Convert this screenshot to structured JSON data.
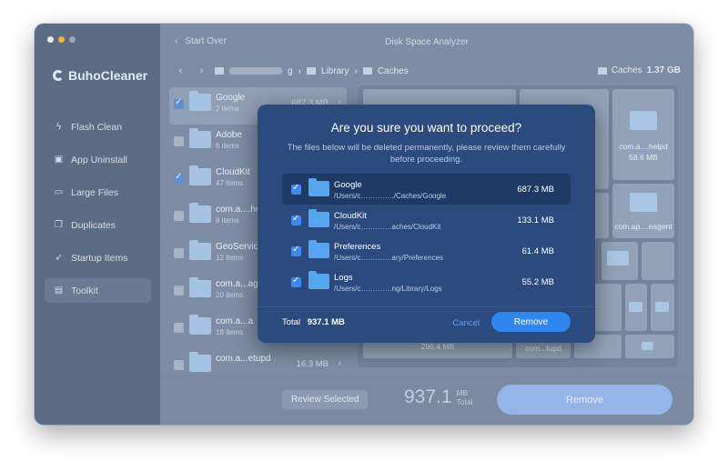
{
  "app": {
    "brand": "BuhoCleaner",
    "window_title": "Disk Space Analyzer",
    "start_over": "Start Over"
  },
  "sidebar": {
    "items": [
      {
        "label": "Flash Clean",
        "icon": "flash-icon"
      },
      {
        "label": "App Uninstall",
        "icon": "uninstall-icon"
      },
      {
        "label": "Large Files",
        "icon": "large-files-icon"
      },
      {
        "label": "Duplicates",
        "icon": "duplicates-icon"
      },
      {
        "label": "Startup Items",
        "icon": "rocket-icon"
      },
      {
        "label": "Toolkit",
        "icon": "toolkit-icon"
      }
    ]
  },
  "breadcrumb": {
    "items": [
      "g",
      "Library",
      "Caches"
    ]
  },
  "folder_summary": {
    "name": "Caches",
    "size": "1.37 GB"
  },
  "file_list": [
    {
      "name": "Google",
      "count": "2 items",
      "size": "687.3 MB",
      "checked": true
    },
    {
      "name": "Adobe",
      "count": "6 items",
      "size": "",
      "checked": false
    },
    {
      "name": "CloudKit",
      "count": "47 items",
      "size": "",
      "checked": true
    },
    {
      "name": "com.a....he",
      "count": "8 items",
      "size": "",
      "checked": false
    },
    {
      "name": "GeoServic",
      "count": "12 items",
      "size": "",
      "checked": false
    },
    {
      "name": "com.a...ag",
      "count": "20 items",
      "size": "",
      "checked": false
    },
    {
      "name": "com.a...a",
      "count": "18 items",
      "size": "",
      "checked": false
    },
    {
      "name": "com.a...etupd",
      "count": "",
      "size": "16.3 MB",
      "checked": false
    }
  ],
  "treemap": {
    "labels": {
      "helpd": "com.a....helpd",
      "helpd_size": "58.6 MB",
      "eagent": "com.ap....eagent",
      "bottom_size": "296.4 MB",
      "tupd": "com...tupd"
    }
  },
  "bottom": {
    "review_label": "Review Selected",
    "total_value": "937.1",
    "total_unit": "MB",
    "total_caption": "Total",
    "remove_label": "Remove"
  },
  "modal": {
    "title": "Are you sure you want to proceed?",
    "description": "The files below will be deleted permanently, please review them carefully before proceeding.",
    "items": [
      {
        "name": "Google",
        "path": "/Users/c…………../Caches/Google",
        "size": "687.3 MB"
      },
      {
        "name": "CloudKit",
        "path": "/Users/c………….aches/CloudKit",
        "size": "133.1 MB"
      },
      {
        "name": "Preferences",
        "path": "/Users/c………….ary/Preferences",
        "size": "61.4 MB"
      },
      {
        "name": "Logs",
        "path": "/Users/c………….ng/Library/Logs",
        "size": "55.2 MB"
      }
    ],
    "total_label": "Total",
    "total_value": "937.1 MB",
    "cancel_label": "Cancel",
    "remove_label": "Remove"
  },
  "colors": {
    "sidebar": "#5c6c85",
    "modal_bg": "#2b4a7e",
    "accent": "#2f86ef",
    "checkbox": "#3e88e9"
  }
}
